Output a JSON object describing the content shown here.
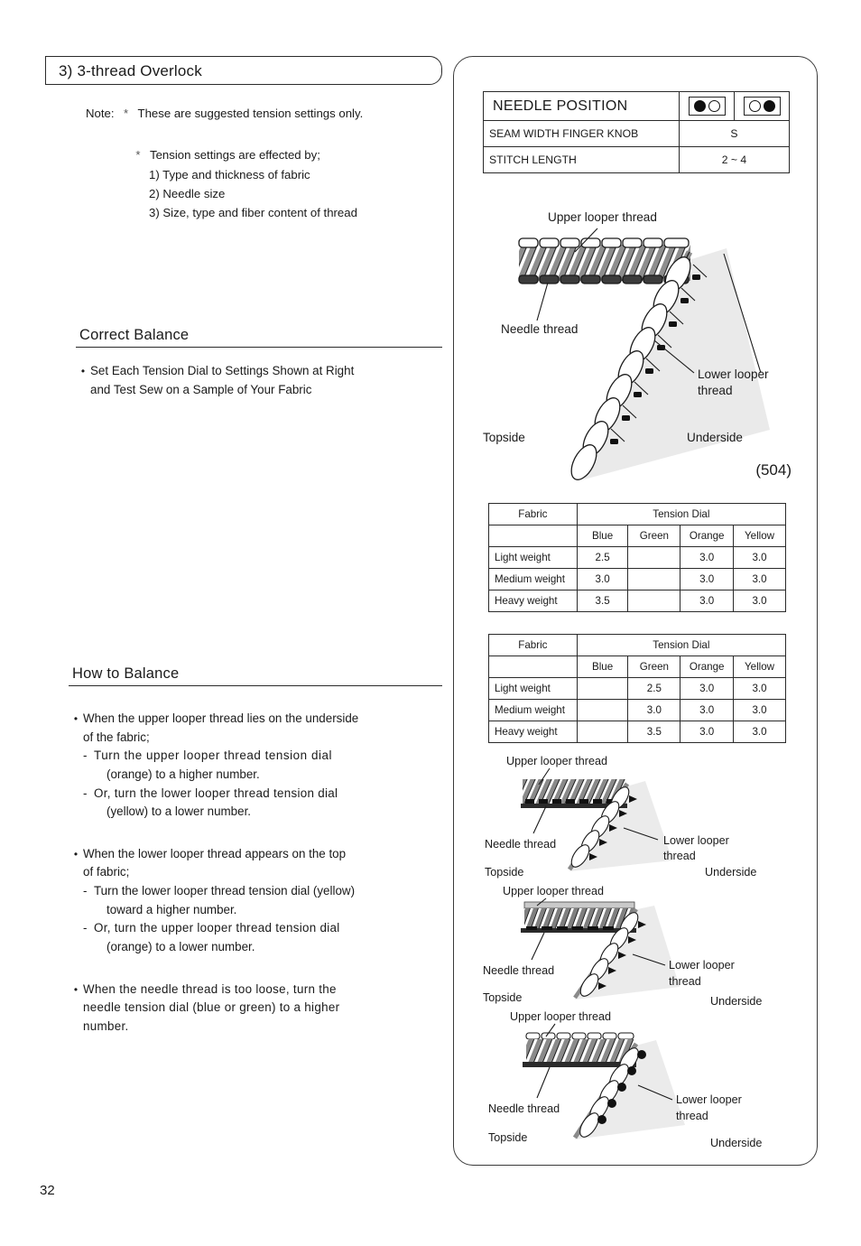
{
  "page": {
    "number": "32"
  },
  "section": {
    "title": "3) 3-thread Overlock"
  },
  "note": {
    "label": "Note:",
    "star": "*",
    "first_line": "These are suggested tension settings only.",
    "second_line": "Tension settings are effected by;",
    "items": [
      "1) Type and thickness of fabric",
      "2) Needle size",
      "3) Size, type and fiber content of thread"
    ]
  },
  "correct_balance": {
    "heading": "Correct Balance",
    "bullet_line1": "Set Each Tension Dial to Settings Shown at Right",
    "bullet_line2": "and Test Sew on a Sample of Your Fabric"
  },
  "how_to_balance": {
    "heading": "How to Balance",
    "bullet1": {
      "line1": "When the upper looper thread lies on the underside",
      "line2": "of the fabric;",
      "sub1_line1": "Turn the upper looper thread tension dial",
      "sub1_line2": "(orange) to a higher number.",
      "sub2_line1": "Or, turn the lower looper thread tension dial",
      "sub2_line2": "(yellow) to a lower number."
    },
    "bullet2": {
      "line1": "When the lower looper thread appears on the top",
      "line2": "of fabric;",
      "sub1_line1": "Turn the lower looper thread tension dial (yellow)",
      "sub1_line2": "toward a higher number.",
      "sub2_line1": "Or, turn the upper looper thread tension dial",
      "sub2_line2": "(orange) to a lower number."
    },
    "bullet3": {
      "line1": "When the needle thread is too loose, turn the",
      "line2": "needle tension dial (blue or green) to a higher",
      "line3": "number."
    },
    "dash": "-"
  },
  "settings_table": {
    "needle_position_label": "NEEDLE POSITION",
    "needle_position_icon_left": "needle-left-filled-right-hollow",
    "needle_position_icon_right": "needle-left-hollow-right-filled",
    "seam_width_label": "SEAM WIDTH FINGER KNOB",
    "seam_width_value": "S",
    "stitch_length_label": "STITCH LENGTH",
    "stitch_length_value": "2 ~ 4"
  },
  "main_diagram": {
    "upper_looper_label": "Upper looper thread",
    "needle_label": "Needle thread",
    "lower_looper_label_line1": "Lower looper",
    "lower_looper_label_line2": "thread",
    "topside_label": "Topside",
    "underside_label": "Underside",
    "code": "(504)"
  },
  "tension_tables": [
    {
      "fabric_header": "Fabric",
      "dial_header": "Tension Dial",
      "columns": [
        "Blue",
        "Green",
        "Orange",
        "Yellow"
      ],
      "rows": [
        {
          "fabric": "Light weight",
          "values": [
            "2.5",
            "",
            "3.0",
            "3.0"
          ]
        },
        {
          "fabric": "Medium weight",
          "values": [
            "3.0",
            "",
            "3.0",
            "3.0"
          ]
        },
        {
          "fabric": "Heavy weight",
          "values": [
            "3.5",
            "",
            "3.0",
            "3.0"
          ]
        }
      ]
    },
    {
      "fabric_header": "Fabric",
      "dial_header": "Tension Dial",
      "columns": [
        "Blue",
        "Green",
        "Orange",
        "Yellow"
      ],
      "rows": [
        {
          "fabric": "Light weight",
          "values": [
            "",
            "2.5",
            "3.0",
            "3.0"
          ]
        },
        {
          "fabric": "Medium weight",
          "values": [
            "",
            "3.0",
            "3.0",
            "3.0"
          ]
        },
        {
          "fabric": "Heavy weight",
          "values": [
            "",
            "3.5",
            "3.0",
            "3.0"
          ]
        }
      ]
    }
  ],
  "small_diagrams": [
    {
      "upper_looper_label": "Upper looper thread",
      "needle_label": "Needle thread",
      "lower_looper_label_line1": "Lower looper",
      "lower_looper_label_line2": "thread",
      "topside_label": "Topside",
      "underside_label": "Underside"
    },
    {
      "upper_looper_label": "Upper looper thread",
      "needle_label": "Needle thread",
      "lower_looper_label_line1": "Lower looper",
      "lower_looper_label_line2": "thread",
      "topside_label": "Topside",
      "underside_label": "Underside"
    },
    {
      "upper_looper_label": "Upper looper thread",
      "needle_label": "Needle thread",
      "lower_looper_label_line1": "Lower looper",
      "lower_looper_label_line2": "thread",
      "topside_label": "Topside",
      "underside_label": "Underside"
    }
  ]
}
